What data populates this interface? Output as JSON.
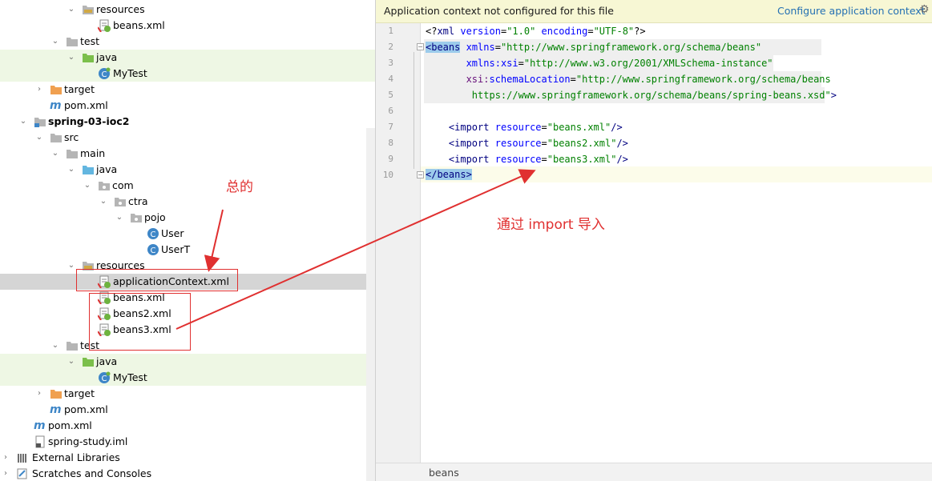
{
  "project_tree": {
    "rows": [
      {
        "label": "resources",
        "icon": "resources-folder-icon",
        "arrow": "v"
      },
      {
        "label": "beans.xml",
        "icon": "spring-xml-icon",
        "arrow": ""
      },
      {
        "label": "test",
        "icon": "folder-icon",
        "arrow": "v"
      },
      {
        "label": "java",
        "icon": "test-source-folder-icon",
        "arrow": "v"
      },
      {
        "label": "MyTest",
        "icon": "class-icon",
        "arrow": ""
      },
      {
        "label": "target",
        "icon": "excluded-folder-icon",
        "arrow": ">"
      },
      {
        "label": "pom.xml",
        "icon": "maven-icon",
        "arrow": ""
      },
      {
        "label": "spring-03-ioc2",
        "icon": "module-icon",
        "arrow": "v"
      },
      {
        "label": "src",
        "icon": "folder-icon",
        "arrow": "v"
      },
      {
        "label": "main",
        "icon": "folder-icon",
        "arrow": "v"
      },
      {
        "label": "java",
        "icon": "source-folder-icon",
        "arrow": "v"
      },
      {
        "label": "com",
        "icon": "package-icon",
        "arrow": "v"
      },
      {
        "label": "ctra",
        "icon": "package-icon",
        "arrow": "v"
      },
      {
        "label": "pojo",
        "icon": "package-icon",
        "arrow": "v"
      },
      {
        "label": "User",
        "icon": "class-icon",
        "arrow": ""
      },
      {
        "label": "UserT",
        "icon": "class-icon",
        "arrow": ""
      },
      {
        "label": "resources",
        "icon": "resources-folder-icon",
        "arrow": "v"
      },
      {
        "label": "applicationContext.xml",
        "icon": "spring-xml-icon",
        "arrow": ""
      },
      {
        "label": "beans.xml",
        "icon": "spring-xml-icon",
        "arrow": ""
      },
      {
        "label": "beans2.xml",
        "icon": "spring-xml-icon",
        "arrow": ""
      },
      {
        "label": "beans3.xml",
        "icon": "spring-xml-icon",
        "arrow": ""
      },
      {
        "label": "test",
        "icon": "folder-icon",
        "arrow": "v"
      },
      {
        "label": "java",
        "icon": "test-source-folder-icon",
        "arrow": "v"
      },
      {
        "label": "MyTest",
        "icon": "class-icon",
        "arrow": ""
      },
      {
        "label": "target",
        "icon": "excluded-folder-icon",
        "arrow": ">"
      },
      {
        "label": "pom.xml",
        "icon": "maven-icon",
        "arrow": ""
      },
      {
        "label": "pom.xml",
        "icon": "maven-icon",
        "arrow": ""
      },
      {
        "label": "spring-study.iml",
        "icon": "iml-file-icon",
        "arrow": ""
      },
      {
        "label": "External Libraries",
        "icon": "libraries-icon",
        "arrow": ">"
      },
      {
        "label": "Scratches and Consoles",
        "icon": "scratches-icon",
        "arrow": ">"
      }
    ]
  },
  "editor": {
    "banner_text": "Application context not configured for this file",
    "banner_link": "Configure application context",
    "line_numbers": [
      "1",
      "2",
      "3",
      "4",
      "5",
      "6",
      "7",
      "8",
      "9",
      "10"
    ],
    "breadcrumb": "beans",
    "code": {
      "l1_open": "<?",
      "l1_tag": "xml",
      "l1_attr1": "version",
      "l1_val1": "\"1.0\"",
      "l1_attr2": "encoding",
      "l1_val2": "\"UTF-8\"",
      "l1_close": "?>",
      "l2_tag": "<beans",
      "l2_attr": "xmlns",
      "l2_val": "\"http://www.springframework.org/schema/beans\"",
      "l3_ns": "xmlns:",
      "l3_attr": "xsi",
      "l3_val": "\"http://www.w3.org/2001/XMLSchema-instance\"",
      "l4_ns": "xsi:",
      "l4_attr": "schemaLocation",
      "l4_val": "\"http://www.springframework.org/schema/beans",
      "l5_val": "https://www.springframework.org/schema/beans/spring-beans.xsd\"",
      "l5_close": ">",
      "l7_tag": "<import",
      "l7_attr": "resource",
      "l7_val": "\"beans.xml\"",
      "l7_close": "/>",
      "l8_tag": "<import",
      "l8_attr": "resource",
      "l8_val": "\"beans2.xml\"",
      "l8_close": "/>",
      "l9_tag": "<import",
      "l9_attr": "resource",
      "l9_val": "\"beans3.xml\"",
      "l9_close": "/>",
      "l10_tag": "</beans>"
    }
  },
  "annotations": {
    "label_main": "总的",
    "label_import": "通过 import 导入",
    "color": "#e03030"
  },
  "colors": {
    "banner_bg": "#f7f7d4",
    "link": "#2470b3",
    "tag_blue": "#000080",
    "attr_blue": "#0000ff",
    "value_green": "#008000",
    "selection_gray": "#d5d5d5",
    "test_tint": "#eef7e4"
  }
}
